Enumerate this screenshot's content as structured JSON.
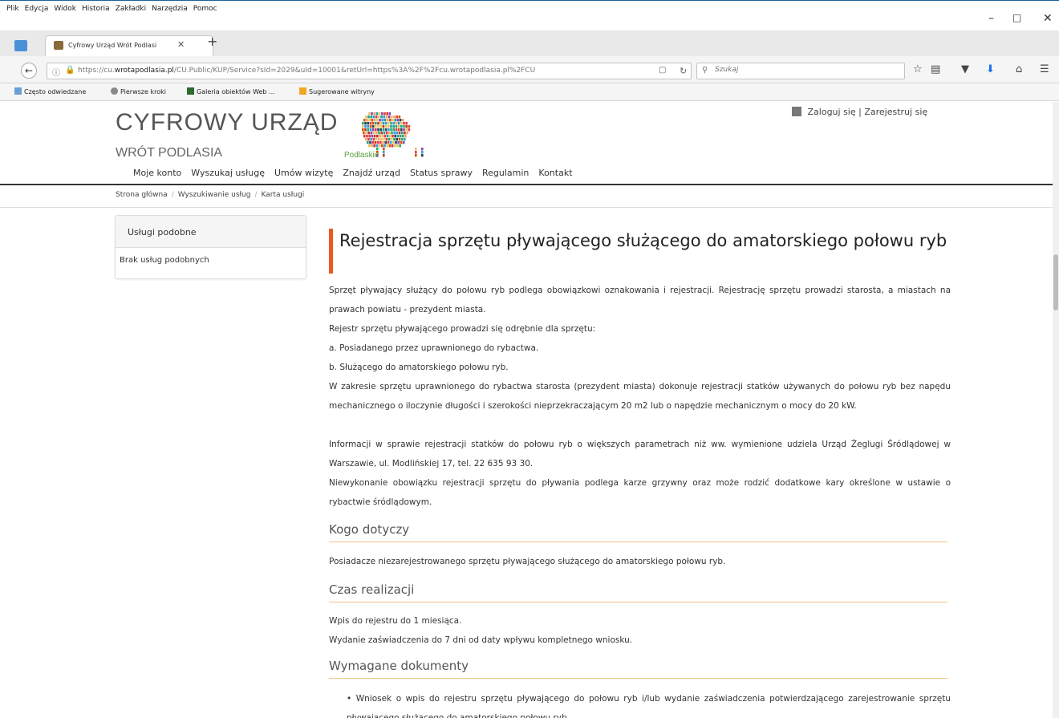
{
  "browser": {
    "menus": [
      "Plik",
      "Edycja",
      "Widok",
      "Historia",
      "Zakładki",
      "Narzędzia",
      "Pomoc"
    ],
    "tab_title": "Cyfrowy Urząd Wrót Podlasi",
    "url_prefix": "https://cu.",
    "url_host": "wrotapodlasia.pl",
    "url_rest": "/CU.Public/KUP/Service?sId=2029&uId=10001&retUrl=https%3A%2F%2Fcu.wrotapodlasia.pl%2FCU",
    "search_placeholder": "Szukaj",
    "bookmarks": [
      "Często odwiedzane",
      "Pierwsze kroki",
      "Galeria obiektów Web ...",
      "Sugerowane witryny"
    ],
    "colors": {
      "accent": "#ea5a1d",
      "section_rule": "#f2c384"
    }
  },
  "header": {
    "logo_title": "CYFROWY URZĄD",
    "logo_sub": "WRÓT PODLASIA",
    "bison_label": "Podlaskie",
    "login": "Zaloguj się",
    "register": "Zarejestruj się",
    "login_separator": "|",
    "nav": [
      "Moje konto",
      "Wyszukaj usługę",
      "Umów wizytę",
      "Znajdź urząd",
      "Status sprawy",
      "Regulamin",
      "Kontakt"
    ]
  },
  "breadcrumb": [
    "Strona główna",
    "Wyszukiwanie usług",
    "Karta usługi"
  ],
  "sidebar": {
    "title": "Usługi podobne",
    "empty": "Brak usług podobnych"
  },
  "main": {
    "title": "Rejestracja sprzętu pływającego służącego do amatorskiego połowu ryb",
    "intro": [
      "Sprzęt pływający służący do połowu ryb podlega obowiązkowi oznakowania i rejestracji. Rejestrację sprzętu prowadzi starosta, a miastach na prawach powiatu - prezydent miasta.",
      "Rejestr sprzętu pływającego prowadzi się odrębnie dla sprzętu:",
      "a. Posiadanego przez uprawnionego do rybactwa.",
      "b. Służącego do amatorskiego połowu ryb.",
      "W zakresie sprzętu uprawnionego do rybactwa starosta (prezydent miasta) dokonuje rejestracji statków używanych do połowu ryb bez napędu mechanicznego o iloczynie długości i szerokości nieprzekraczającym 20 m2 lub o napędzie mechanicznym o mocy do 20 kW.",
      "Informacji w sprawie rejestracji statków do połowu ryb o większych parametrach niż ww. wymienione udziela Urząd Żeglugi Śródlądowej w Warszawie, ul. Modlińskiej 17, tel. 22 635 93 30.",
      "Niewykonanie obowiązku rejestracji sprzętu do pływania podlega karze grzywny oraz może rodzić dodatkowe kary określone w ustawie o rybactwie śródlądowym."
    ],
    "sections": [
      {
        "title": "Kogo dotyczy",
        "lines": [
          "Posiadacze niezarejestrowanego sprzętu pływającego służącego do amatorskiego połowu ryb."
        ]
      },
      {
        "title": "Czas realizacji",
        "lines": [
          "Wpis do rejestru do 1 miesiąca.",
          "Wydanie zaświadczenia do 7 dni od daty wpływu kompletnego wniosku."
        ]
      },
      {
        "title": "Wymagane dokumenty",
        "lines": [
          "Wniosek o wpis do rejestru sprzętu pływającego do połowu ryb i/lub wydanie zaświadczenia potwierdzającego zarejestrowanie sprzętu pływającego służącego do amatorskiego połowu ryb."
        ]
      }
    ]
  }
}
